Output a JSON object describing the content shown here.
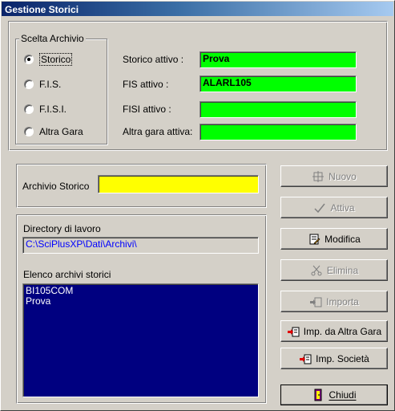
{
  "window": {
    "title": "Gestione Storici"
  },
  "scelta": {
    "legend": "Scelta Archivio",
    "options": [
      {
        "label": "Storico",
        "selected": true
      },
      {
        "label": "F.I.S.",
        "selected": false
      },
      {
        "label": "F.I.S.I.",
        "selected": false
      },
      {
        "label": "Altra Gara",
        "selected": false
      }
    ]
  },
  "attivi": [
    {
      "label": "Storico attivo :",
      "value": "Prova"
    },
    {
      "label": "FIS attivo :",
      "value": "ALARL105"
    },
    {
      "label": "FISI attivo :",
      "value": ""
    },
    {
      "label": "Altra gara attiva:",
      "value": ""
    }
  ],
  "archivio": {
    "label": "Archivio Storico",
    "value": ""
  },
  "directory": {
    "label": "Directory di lavoro",
    "value": "C:\\SciPlusXP\\Dati\\Archivi\\"
  },
  "elenco": {
    "label": "Elenco archivi storici",
    "items": [
      "BI105COM",
      "Prova"
    ]
  },
  "buttons": {
    "nuovo": "Nuovo",
    "attiva": "Attiva",
    "modifica": "Modifica",
    "elimina": "Elimina",
    "importa": "Importa",
    "imp_altra_gara": "Imp. da Altra Gara",
    "imp_societa": "Imp. Società",
    "chiudi": "Chiudi"
  },
  "colors": {
    "active_field": "#00ff00",
    "archive_field": "#ffff00",
    "list_background": "#000080",
    "path_text": "#0000ff"
  },
  "icons": [
    "nuovo-icon",
    "checkmark-icon",
    "edit-document-icon",
    "scissors-icon",
    "import-icon",
    "import-red-icon",
    "import-red-icon",
    "door-exit-icon"
  ]
}
